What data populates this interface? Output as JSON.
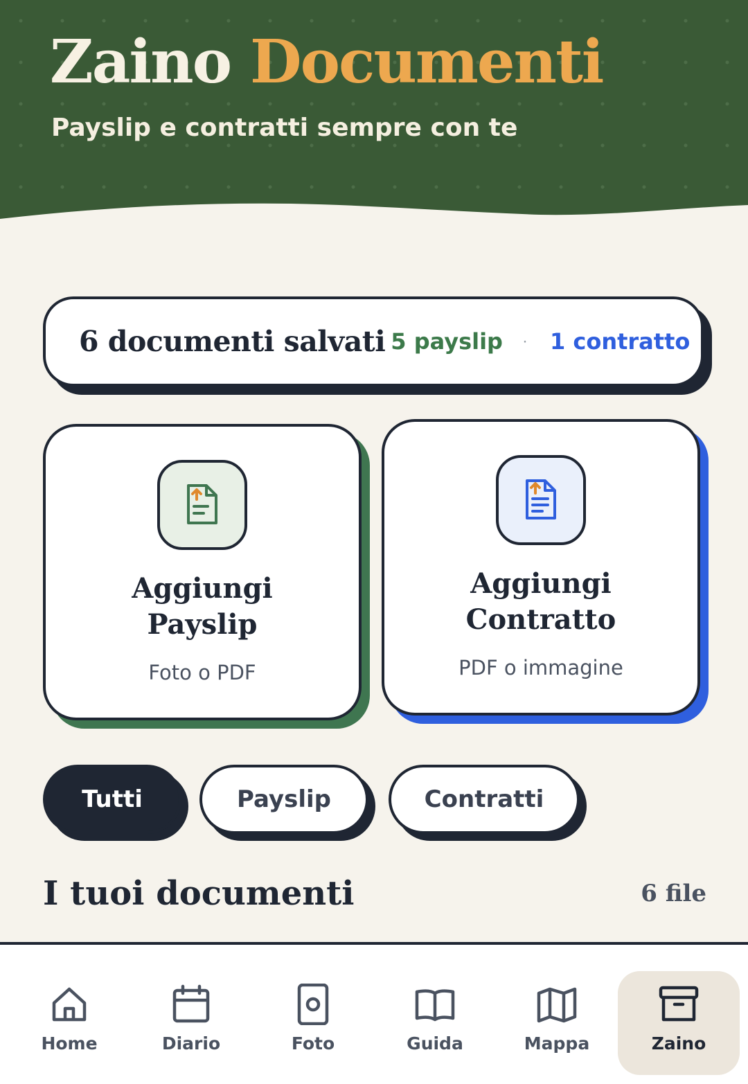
{
  "header": {
    "title_word1": "Zaino",
    "title_word2": "Documenti",
    "subtitle": "Payslip e contratti sempre con te"
  },
  "summary": {
    "total": "6 documenti salvati",
    "payslip_count": "5 payslip",
    "separator": "·",
    "contract_count": "1 contratto"
  },
  "actions": [
    {
      "title_line1": "Aggiungi",
      "title_line2": "Payslip",
      "subtitle": "Foto o PDF",
      "icon": "document-upload-icon",
      "accent": "#3f7650"
    },
    {
      "title_line1": "Aggiungi",
      "title_line2": "Contratto",
      "subtitle": "PDF o immagine",
      "icon": "document-upload-icon",
      "accent": "#2f5fde"
    }
  ],
  "filters": [
    {
      "label": "Tutti",
      "active": true
    },
    {
      "label": "Payslip",
      "active": false
    },
    {
      "label": "Contratti",
      "active": false
    }
  ],
  "documents_section": {
    "title": "I tuoi documenti",
    "count": "6 file"
  },
  "bottom_nav": [
    {
      "label": "Home",
      "icon": "home-icon"
    },
    {
      "label": "Diario",
      "icon": "calendar-icon"
    },
    {
      "label": "Foto",
      "icon": "camera-icon"
    },
    {
      "label": "Guida",
      "icon": "book-icon"
    },
    {
      "label": "Mappa",
      "icon": "map-icon"
    },
    {
      "label": "Zaino",
      "icon": "archive-icon",
      "active": true
    }
  ],
  "colors": {
    "header_bg": "#3a5a36",
    "title_accent": "#eda84f",
    "payslip_green": "#3c7a4a",
    "contract_blue": "#2f5fde",
    "ink": "#1f2633",
    "page_bg": "#f6f3ec"
  }
}
